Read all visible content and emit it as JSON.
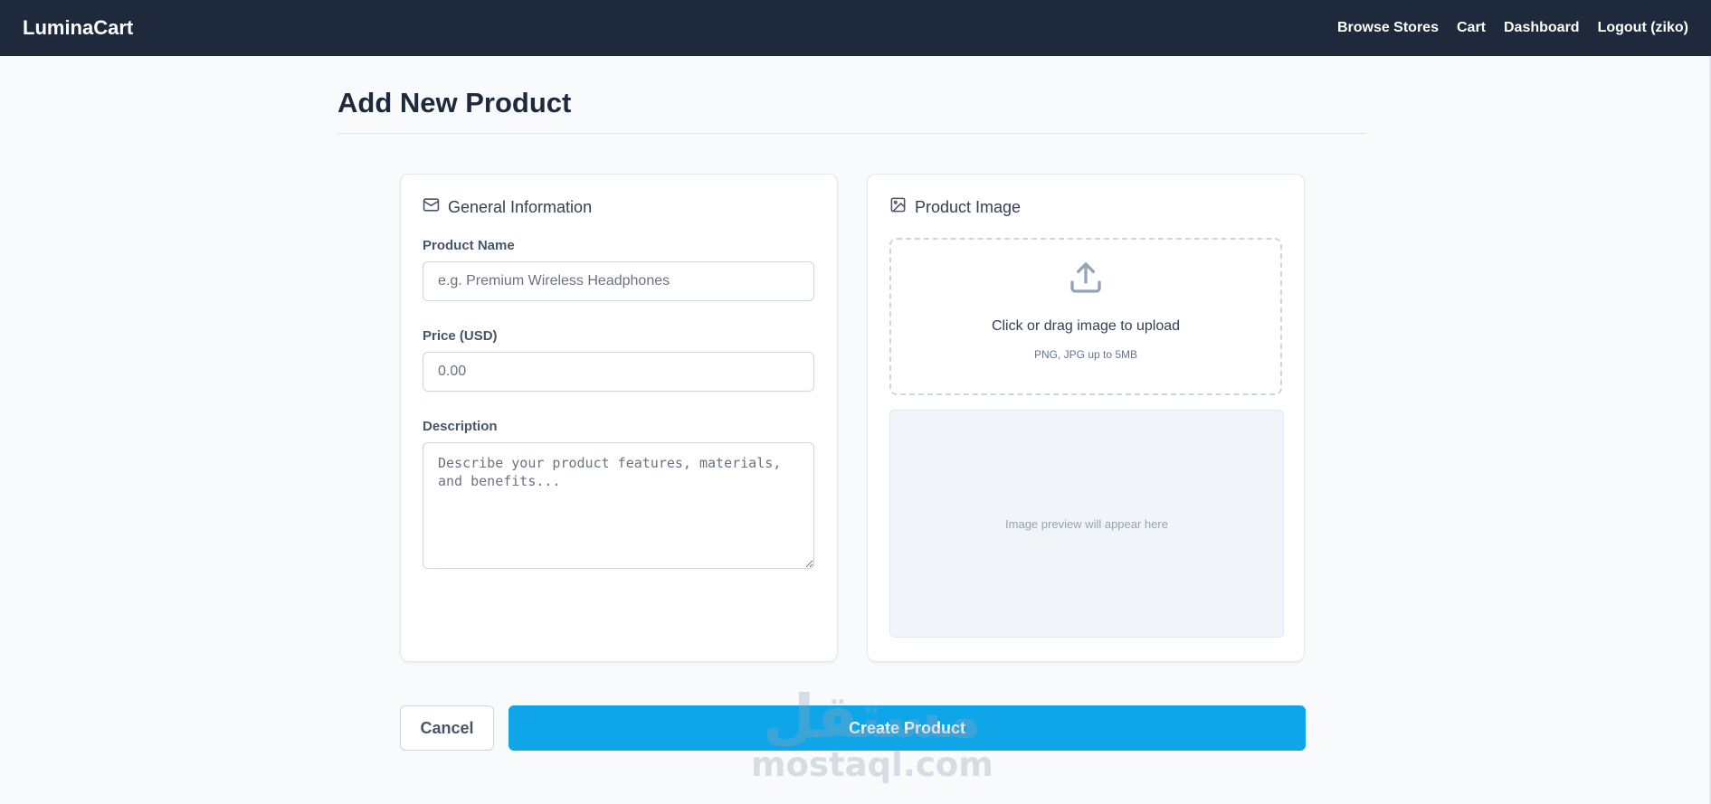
{
  "app": {
    "brand": "LuminaCart"
  },
  "nav": {
    "items": [
      {
        "label": "Browse Stores"
      },
      {
        "label": "Cart"
      },
      {
        "label": "Dashboard"
      },
      {
        "label": "Logout (ziko)"
      }
    ]
  },
  "page": {
    "title": "Add New Product"
  },
  "general": {
    "title": "General Information",
    "icon": "envelope-icon",
    "product_name_label": "Product Name",
    "product_name_placeholder": "e.g. Premium Wireless Headphones",
    "product_name_value": "",
    "price_label": "Price (USD)",
    "price_placeholder": "0.00",
    "price_value": "",
    "description_label": "Description",
    "description_placeholder": "Describe your product features, materials, and benefits...",
    "description_value": ""
  },
  "image": {
    "title": "Product Image",
    "icon": "image-icon",
    "upload_icon": "upload-icon",
    "upload_text": "Click or drag image to upload",
    "upload_hint": "PNG, JPG up to 5MB",
    "preview_text": "Image preview will appear here"
  },
  "actions": {
    "cancel_label": "Cancel",
    "create_label": "Create Product"
  },
  "watermark": {
    "arabic": "مستقل",
    "latin": "mostaql.com"
  },
  "colors": {
    "navbar": "#1e293b",
    "accent": "#0ea5e9",
    "background": "#f8fafc"
  }
}
